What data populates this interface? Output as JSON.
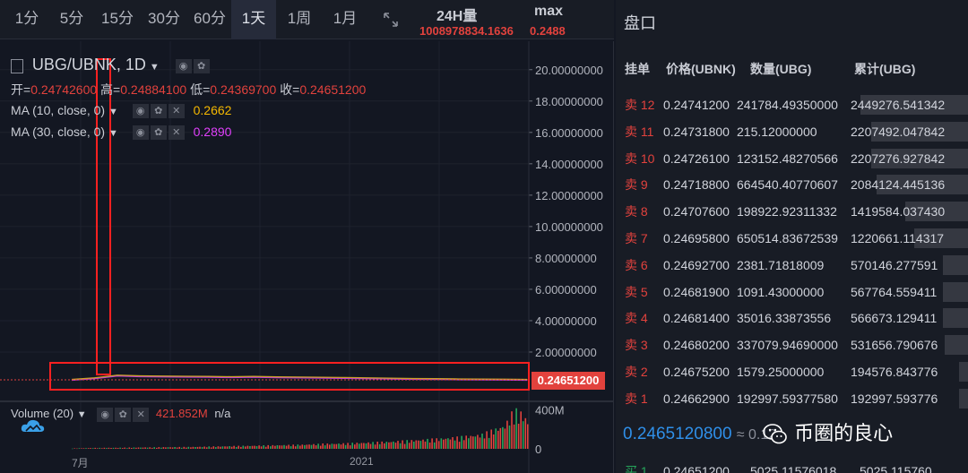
{
  "toolbar": {
    "timeframes": [
      {
        "label": "1分"
      },
      {
        "label": "5分"
      },
      {
        "label": "15分"
      },
      {
        "label": "30分"
      },
      {
        "label": "60分"
      },
      {
        "label": "1天",
        "active": true
      },
      {
        "label": "1周"
      },
      {
        "label": "1月"
      }
    ],
    "fullscreen_icon": "fullscreen-icon",
    "volume_24h_label": "24H量",
    "volume_24h_value": "1008978834.1636",
    "max_label": "max",
    "max_value": "0.2488"
  },
  "chart": {
    "symbol": "UBG/UBNK, 1D",
    "ohlc": {
      "open_label": "开=",
      "open": "0.24742600",
      "high_label": "高=",
      "high": "0.24884100",
      "low_label": "低=",
      "low": "0.24369700",
      "close_label": "收=",
      "close": "0.24651200"
    },
    "ma10": {
      "label": "MA (10, close, 0)",
      "value": "0.2662",
      "color": "#f5b800"
    },
    "ma30": {
      "label": "MA (30, close, 0)",
      "value": "0.2890",
      "color": "#e040fb"
    },
    "last_price_tag": "0.24651200",
    "volume_legend": {
      "label": "Volume (20)",
      "value": "421.852M",
      "suffix": "n/a"
    },
    "x_labels": [
      "7月",
      "2021"
    ]
  },
  "chart_data": {
    "type": "line",
    "title": "UBG/UBNK, 1D",
    "xlabel": "",
    "ylabel": "",
    "x_tick_labels": [
      "7月",
      "2021"
    ],
    "y_ticks": [
      "20.00000000",
      "18.00000000",
      "16.00000000",
      "14.00000000",
      "12.00000000",
      "10.00000000",
      "8.00000000",
      "6.00000000",
      "4.00000000",
      "2.00000000"
    ],
    "ylim": [
      0,
      20.5
    ],
    "price": {
      "x": [
        0,
        5,
        10,
        15,
        20,
        25,
        30,
        35,
        40,
        45,
        50,
        55,
        60,
        65,
        70,
        75,
        80,
        85,
        90,
        95,
        100
      ],
      "values": [
        0.25,
        0.35,
        0.52,
        0.48,
        0.46,
        0.45,
        0.44,
        0.42,
        0.44,
        0.41,
        0.4,
        0.38,
        0.37,
        0.35,
        0.33,
        0.31,
        0.3,
        0.28,
        0.27,
        0.26,
        0.25
      ]
    },
    "volume": {
      "y_ticks": [
        "400M",
        "0"
      ],
      "ylim": [
        0,
        460
      ],
      "x": [
        0,
        5,
        10,
        15,
        20,
        25,
        30,
        35,
        40,
        45,
        50,
        55,
        60,
        65,
        70,
        75,
        80,
        85,
        90,
        95,
        97,
        99,
        100
      ],
      "values": [
        5,
        10,
        12,
        15,
        18,
        20,
        25,
        30,
        35,
        40,
        45,
        55,
        60,
        70,
        80,
        95,
        110,
        130,
        160,
        260,
        430,
        380,
        300
      ]
    },
    "grid": true,
    "legend_position": "top-left"
  },
  "orderbook": {
    "title": "盘口",
    "headers": {
      "side": "挂单",
      "price": "价格(UBNK)",
      "qty": "数量(UBG)",
      "cum": "累计(UBG)"
    },
    "asks": [
      {
        "label": "卖 12",
        "price": "0.24741200",
        "qty": "241784.49350000",
        "cum": "2449276.541342",
        "depth": 1.0
      },
      {
        "label": "卖 11",
        "price": "0.24731800",
        "qty": "215.12000000",
        "cum": "2207492.047842",
        "depth": 0.9
      },
      {
        "label": "卖 10",
        "price": "0.24726100",
        "qty": "123152.48270566",
        "cum": "2207276.927842",
        "depth": 0.9
      },
      {
        "label": "卖 9",
        "price": "0.24718800",
        "qty": "664540.40770607",
        "cum": "2084124.445136",
        "depth": 0.85
      },
      {
        "label": "卖 8",
        "price": "0.24707600",
        "qty": "198922.92311332",
        "cum": "1419584.037430",
        "depth": 0.58
      },
      {
        "label": "卖 7",
        "price": "0.24695800",
        "qty": "650514.83672539",
        "cum": "1220661.114317",
        "depth": 0.5
      },
      {
        "label": "卖 6",
        "price": "0.24692700",
        "qty": "2381.71818009",
        "cum": "570146.277591",
        "depth": 0.23
      },
      {
        "label": "卖 5",
        "price": "0.24681900",
        "qty": "1091.43000000",
        "cum": "567764.559411",
        "depth": 0.23
      },
      {
        "label": "卖 4",
        "price": "0.24681400",
        "qty": "35016.33873556",
        "cum": "566673.129411",
        "depth": 0.23
      },
      {
        "label": "卖 3",
        "price": "0.24680200",
        "qty": "337079.94690000",
        "cum": "531656.790676",
        "depth": 0.22
      },
      {
        "label": "卖 2",
        "price": "0.24675200",
        "qty": "1579.25000000",
        "cum": "194576.843776",
        "depth": 0.08
      },
      {
        "label": "卖 1",
        "price": "0.24662900",
        "qty": "192997.59377580",
        "cum": "192997.593776",
        "depth": 0.08
      }
    ],
    "last_price": "0.2465120800",
    "last_price_approx": "≈ 0.12",
    "bid_partial": {
      "label": "买 1",
      "price": "0.24651200",
      "qty": "5025.11576018",
      "cum": "5025.115760"
    }
  },
  "watermark": {
    "text": "币圈的良心"
  },
  "colors": {
    "up": "#e2423d",
    "down": "#26a65b",
    "accent": "#2f8fe8",
    "highlight": "#ff2020"
  }
}
